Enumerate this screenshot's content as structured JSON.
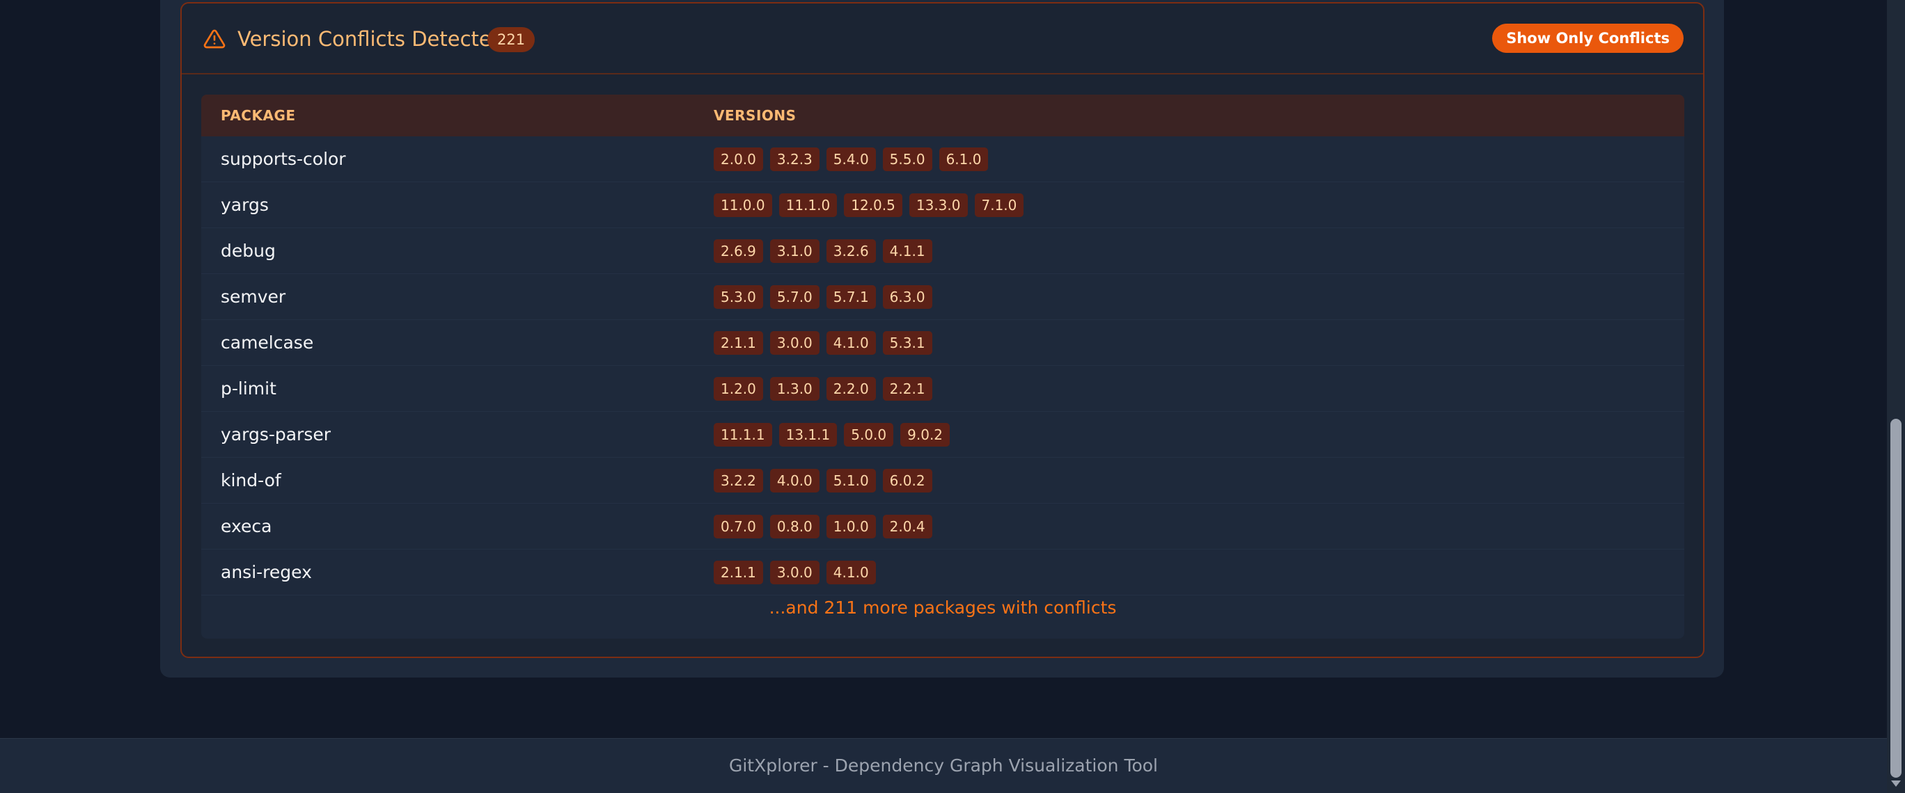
{
  "conflicts": {
    "title": "Version Conflicts Detected",
    "count": "221",
    "toggle_label": "Show Only Conflicts",
    "columns": {
      "package": "PACKAGE",
      "versions": "VERSIONS"
    },
    "rows": [
      {
        "name": "supports-color",
        "versions": [
          "2.0.0",
          "3.2.3",
          "5.4.0",
          "5.5.0",
          "6.1.0"
        ]
      },
      {
        "name": "yargs",
        "versions": [
          "11.0.0",
          "11.1.0",
          "12.0.5",
          "13.3.0",
          "7.1.0"
        ]
      },
      {
        "name": "debug",
        "versions": [
          "2.6.9",
          "3.1.0",
          "3.2.6",
          "4.1.1"
        ]
      },
      {
        "name": "semver",
        "versions": [
          "5.3.0",
          "5.7.0",
          "5.7.1",
          "6.3.0"
        ]
      },
      {
        "name": "camelcase",
        "versions": [
          "2.1.1",
          "3.0.0",
          "4.1.0",
          "5.3.1"
        ]
      },
      {
        "name": "p-limit",
        "versions": [
          "1.2.0",
          "1.3.0",
          "2.2.0",
          "2.2.1"
        ]
      },
      {
        "name": "yargs-parser",
        "versions": [
          "11.1.1",
          "13.1.1",
          "5.0.0",
          "9.0.2"
        ]
      },
      {
        "name": "kind-of",
        "versions": [
          "3.2.2",
          "4.0.0",
          "5.1.0",
          "6.0.2"
        ]
      },
      {
        "name": "execa",
        "versions": [
          "0.7.0",
          "0.8.0",
          "1.0.0",
          "2.0.4"
        ]
      },
      {
        "name": "ansi-regex",
        "versions": [
          "2.1.1",
          "3.0.0",
          "4.1.0"
        ]
      }
    ],
    "more_note": "...and 211 more packages with conflicts"
  },
  "footer": {
    "text": "GitXplorer - Dependency Graph Visualization Tool"
  },
  "icons": {
    "warning": "warning-triangle-icon"
  },
  "colors": {
    "accent": "#ea580c",
    "warning": "#f97316",
    "tag_bg": "#5c2117"
  }
}
